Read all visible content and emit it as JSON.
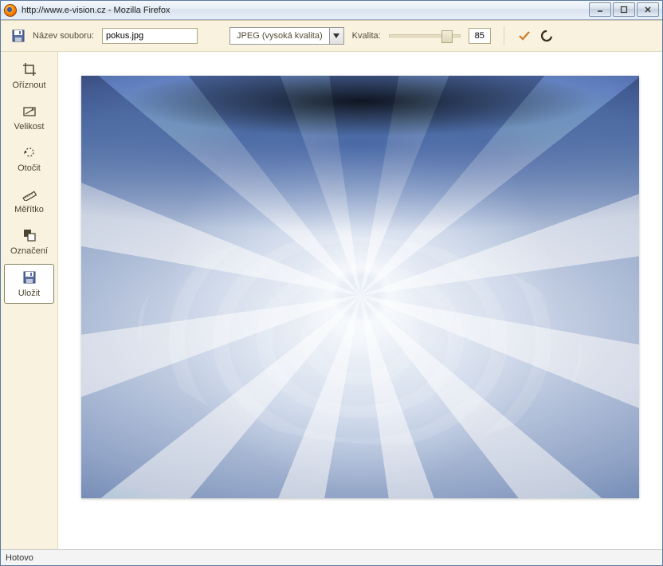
{
  "window": {
    "title": "http://www.e-vision.cz - Mozilla Firefox"
  },
  "toolbar": {
    "filename_label": "Název souboru:",
    "filename_value": "pokus.jpg",
    "format_selected": "JPEG (vysoká kvalita)",
    "quality_label": "Kvalita:",
    "quality_value": "85"
  },
  "sidebar": {
    "items": [
      {
        "label": "Oříznout"
      },
      {
        "label": "Velikost"
      },
      {
        "label": "Otočit"
      },
      {
        "label": "Měřítko"
      },
      {
        "label": "Označení"
      },
      {
        "label": "Uložit"
      }
    ]
  },
  "status": {
    "text": "Hotovo"
  }
}
